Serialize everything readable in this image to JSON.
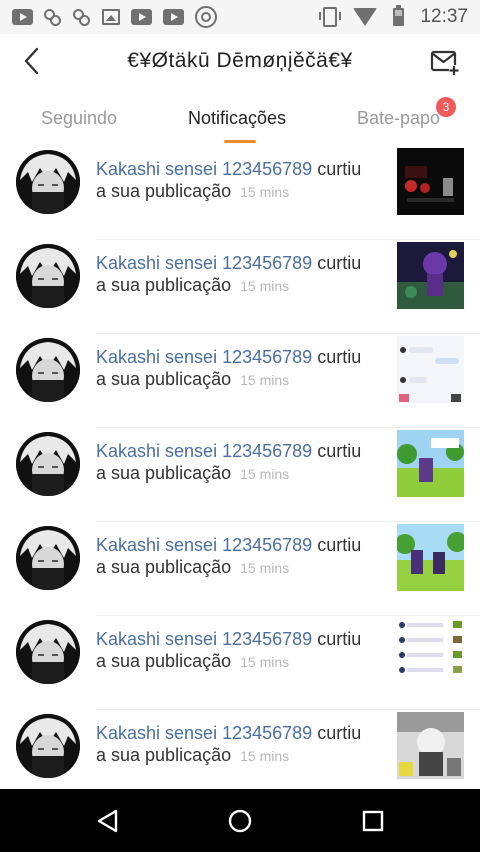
{
  "status_bar": {
    "time": "12:37",
    "left_icons": [
      "youtube-icon",
      "cs-icon",
      "cs-icon",
      "gallery-icon",
      "youtube-icon",
      "youtube-icon",
      "chrome-icon"
    ],
    "right_icons": [
      "vibrate-icon",
      "wifi-icon",
      "battery-icon"
    ]
  },
  "header": {
    "title": "€¥Øtäkū Dēmøņįěčä€¥",
    "back_icon": "chevron-left-icon",
    "compose_icon": "mail-plus-icon"
  },
  "tabs": [
    {
      "label": "Seguindo"
    },
    {
      "label": "Notificações"
    },
    {
      "label": "Bate-papo",
      "badge": "3"
    }
  ],
  "notifications": [
    {
      "user": "Kakashi sensei 123456789",
      "action": "curtiu",
      "object": "a sua publicação",
      "time": "15 mins"
    },
    {
      "user": "Kakashi sensei 123456789",
      "action": "curtiu",
      "object": "a sua publicação",
      "time": "15 mins"
    },
    {
      "user": "Kakashi sensei 123456789",
      "action": "curtiu",
      "object": "a sua publicação",
      "time": "15 mins"
    },
    {
      "user": "Kakashi sensei 123456789",
      "action": "curtiu",
      "object": "a sua publicação",
      "time": "15 mins"
    },
    {
      "user": "Kakashi sensei 123456789",
      "action": "curtiu",
      "object": "a sua publicação",
      "time": "15 mins"
    },
    {
      "user": "Kakashi sensei 123456789",
      "action": "curtiu",
      "object": "a sua publicação",
      "time": "15 mins"
    },
    {
      "user": "Kakashi sensei 123456789",
      "action": "curtiu",
      "object": "a sua publicação",
      "time": "15 mins"
    }
  ],
  "nav_bar": {
    "back": "nav-back-icon",
    "home": "nav-home-icon",
    "recents": "nav-recents-icon"
  },
  "colors": {
    "accent": "#f08a2c",
    "username": "#4a6fa0",
    "badge": "#f05a5a"
  }
}
